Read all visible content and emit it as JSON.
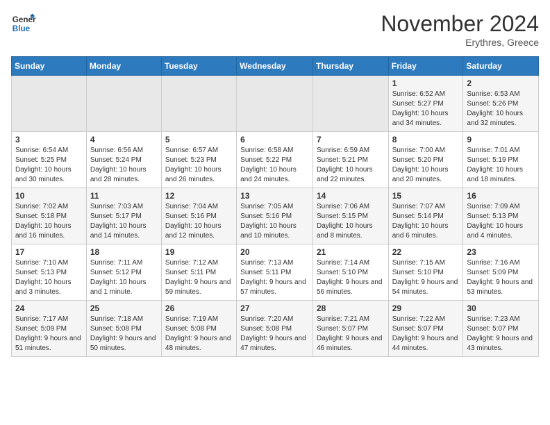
{
  "header": {
    "logo_line1": "General",
    "logo_line2": "Blue",
    "month": "November 2024",
    "location": "Erythres, Greece"
  },
  "weekdays": [
    "Sunday",
    "Monday",
    "Tuesday",
    "Wednesday",
    "Thursday",
    "Friday",
    "Saturday"
  ],
  "weeks": [
    [
      {
        "day": "",
        "info": ""
      },
      {
        "day": "",
        "info": ""
      },
      {
        "day": "",
        "info": ""
      },
      {
        "day": "",
        "info": ""
      },
      {
        "day": "",
        "info": ""
      },
      {
        "day": "1",
        "info": "Sunrise: 6:52 AM\nSunset: 5:27 PM\nDaylight: 10 hours and 34 minutes."
      },
      {
        "day": "2",
        "info": "Sunrise: 6:53 AM\nSunset: 5:26 PM\nDaylight: 10 hours and 32 minutes."
      }
    ],
    [
      {
        "day": "3",
        "info": "Sunrise: 6:54 AM\nSunset: 5:25 PM\nDaylight: 10 hours and 30 minutes."
      },
      {
        "day": "4",
        "info": "Sunrise: 6:56 AM\nSunset: 5:24 PM\nDaylight: 10 hours and 28 minutes."
      },
      {
        "day": "5",
        "info": "Sunrise: 6:57 AM\nSunset: 5:23 PM\nDaylight: 10 hours and 26 minutes."
      },
      {
        "day": "6",
        "info": "Sunrise: 6:58 AM\nSunset: 5:22 PM\nDaylight: 10 hours and 24 minutes."
      },
      {
        "day": "7",
        "info": "Sunrise: 6:59 AM\nSunset: 5:21 PM\nDaylight: 10 hours and 22 minutes."
      },
      {
        "day": "8",
        "info": "Sunrise: 7:00 AM\nSunset: 5:20 PM\nDaylight: 10 hours and 20 minutes."
      },
      {
        "day": "9",
        "info": "Sunrise: 7:01 AM\nSunset: 5:19 PM\nDaylight: 10 hours and 18 minutes."
      }
    ],
    [
      {
        "day": "10",
        "info": "Sunrise: 7:02 AM\nSunset: 5:18 PM\nDaylight: 10 hours and 16 minutes."
      },
      {
        "day": "11",
        "info": "Sunrise: 7:03 AM\nSunset: 5:17 PM\nDaylight: 10 hours and 14 minutes."
      },
      {
        "day": "12",
        "info": "Sunrise: 7:04 AM\nSunset: 5:16 PM\nDaylight: 10 hours and 12 minutes."
      },
      {
        "day": "13",
        "info": "Sunrise: 7:05 AM\nSunset: 5:16 PM\nDaylight: 10 hours and 10 minutes."
      },
      {
        "day": "14",
        "info": "Sunrise: 7:06 AM\nSunset: 5:15 PM\nDaylight: 10 hours and 8 minutes."
      },
      {
        "day": "15",
        "info": "Sunrise: 7:07 AM\nSunset: 5:14 PM\nDaylight: 10 hours and 6 minutes."
      },
      {
        "day": "16",
        "info": "Sunrise: 7:09 AM\nSunset: 5:13 PM\nDaylight: 10 hours and 4 minutes."
      }
    ],
    [
      {
        "day": "17",
        "info": "Sunrise: 7:10 AM\nSunset: 5:13 PM\nDaylight: 10 hours and 3 minutes."
      },
      {
        "day": "18",
        "info": "Sunrise: 7:11 AM\nSunset: 5:12 PM\nDaylight: 10 hours and 1 minute."
      },
      {
        "day": "19",
        "info": "Sunrise: 7:12 AM\nSunset: 5:11 PM\nDaylight: 9 hours and 59 minutes."
      },
      {
        "day": "20",
        "info": "Sunrise: 7:13 AM\nSunset: 5:11 PM\nDaylight: 9 hours and 57 minutes."
      },
      {
        "day": "21",
        "info": "Sunrise: 7:14 AM\nSunset: 5:10 PM\nDaylight: 9 hours and 56 minutes."
      },
      {
        "day": "22",
        "info": "Sunrise: 7:15 AM\nSunset: 5:10 PM\nDaylight: 9 hours and 54 minutes."
      },
      {
        "day": "23",
        "info": "Sunrise: 7:16 AM\nSunset: 5:09 PM\nDaylight: 9 hours and 53 minutes."
      }
    ],
    [
      {
        "day": "24",
        "info": "Sunrise: 7:17 AM\nSunset: 5:09 PM\nDaylight: 9 hours and 51 minutes."
      },
      {
        "day": "25",
        "info": "Sunrise: 7:18 AM\nSunset: 5:08 PM\nDaylight: 9 hours and 50 minutes."
      },
      {
        "day": "26",
        "info": "Sunrise: 7:19 AM\nSunset: 5:08 PM\nDaylight: 9 hours and 48 minutes."
      },
      {
        "day": "27",
        "info": "Sunrise: 7:20 AM\nSunset: 5:08 PM\nDaylight: 9 hours and 47 minutes."
      },
      {
        "day": "28",
        "info": "Sunrise: 7:21 AM\nSunset: 5:07 PM\nDaylight: 9 hours and 46 minutes."
      },
      {
        "day": "29",
        "info": "Sunrise: 7:22 AM\nSunset: 5:07 PM\nDaylight: 9 hours and 44 minutes."
      },
      {
        "day": "30",
        "info": "Sunrise: 7:23 AM\nSunset: 5:07 PM\nDaylight: 9 hours and 43 minutes."
      }
    ]
  ]
}
